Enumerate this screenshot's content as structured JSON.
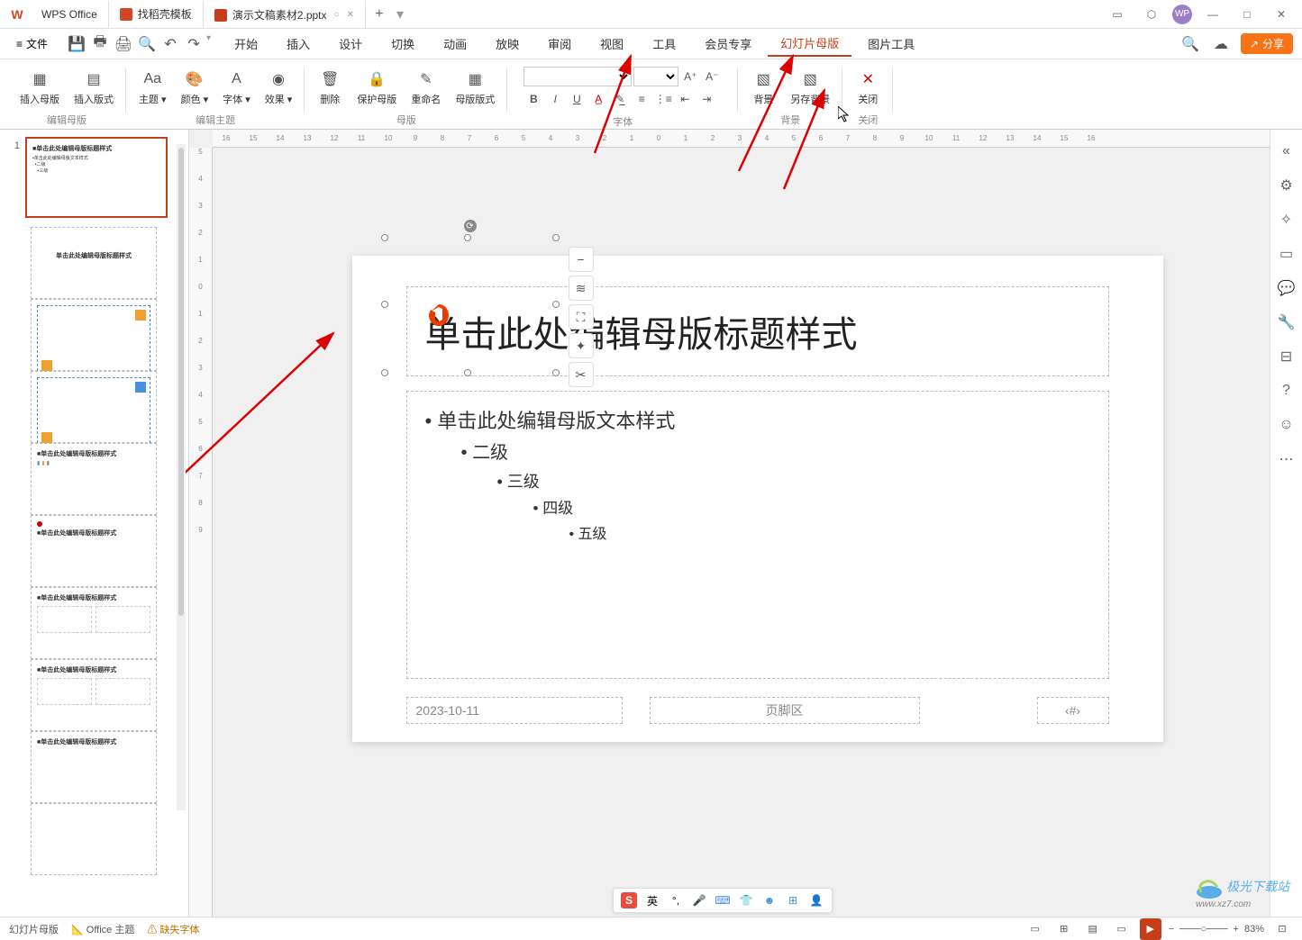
{
  "app": {
    "name": "WPS Office"
  },
  "tabs": [
    {
      "label": "WPS Office"
    },
    {
      "label": "找稻壳模板"
    },
    {
      "label": "演示文稿素材2.pptx"
    }
  ],
  "window_controls": {
    "min": "—",
    "max": "□",
    "close": "✕"
  },
  "file_menu": "文件",
  "menu": [
    "开始",
    "插入",
    "设计",
    "切换",
    "动画",
    "放映",
    "审阅",
    "视图",
    "工具",
    "会员专享",
    "幻灯片母版",
    "图片工具"
  ],
  "active_menu_index": 10,
  "share_btn": "分享",
  "ribbon": {
    "edit_master": {
      "insert_master": "插入母版",
      "insert_layout": "插入版式",
      "label": "编辑母版"
    },
    "edit_theme": {
      "theme": "主题",
      "color": "颜色",
      "font": "字体",
      "effect": "效果",
      "label": "编辑主题"
    },
    "master": {
      "delete": "删除",
      "protect": "保护母版",
      "rename": "重命名",
      "layout_format": "母版版式",
      "label": "母版"
    },
    "font_group_label": "字体",
    "background": {
      "bg": "背景",
      "save_bg": "另存背景",
      "label": "背景"
    },
    "close": {
      "close": "关闭",
      "label": "关闭"
    }
  },
  "slide": {
    "title": "单击此处编辑母版标题样式",
    "body_lvl1": "单击此处编辑母版文本样式",
    "body_lvl2": "二级",
    "body_lvl3": "三级",
    "body_lvl4": "四级",
    "body_lvl5": "五级",
    "date": "2023-10-11",
    "footer": "页脚区",
    "page_num": "‹#›"
  },
  "thumbs": {
    "master_num": "1"
  },
  "status": {
    "mode": "幻灯片母版",
    "theme": "Office 主题",
    "font_warning": "缺失字体",
    "zoom": "83%"
  },
  "ime": {
    "lang": "英"
  },
  "watermark": {
    "main": "极光下载站",
    "sub": "www.xz7.com"
  },
  "ruler_h": [
    "16",
    "15",
    "14",
    "13",
    "12",
    "11",
    "10",
    "9",
    "8",
    "7",
    "6",
    "5",
    "4",
    "3",
    "2",
    "1",
    "0",
    "1",
    "2",
    "3",
    "4",
    "5",
    "6",
    "7",
    "8",
    "9",
    "10",
    "11",
    "12",
    "13",
    "14",
    "15",
    "16"
  ],
  "ruler_v": [
    "5",
    "4",
    "3",
    "2",
    "1",
    "0",
    "1",
    "2",
    "3",
    "4",
    "5",
    "6",
    "7",
    "8",
    "9"
  ]
}
